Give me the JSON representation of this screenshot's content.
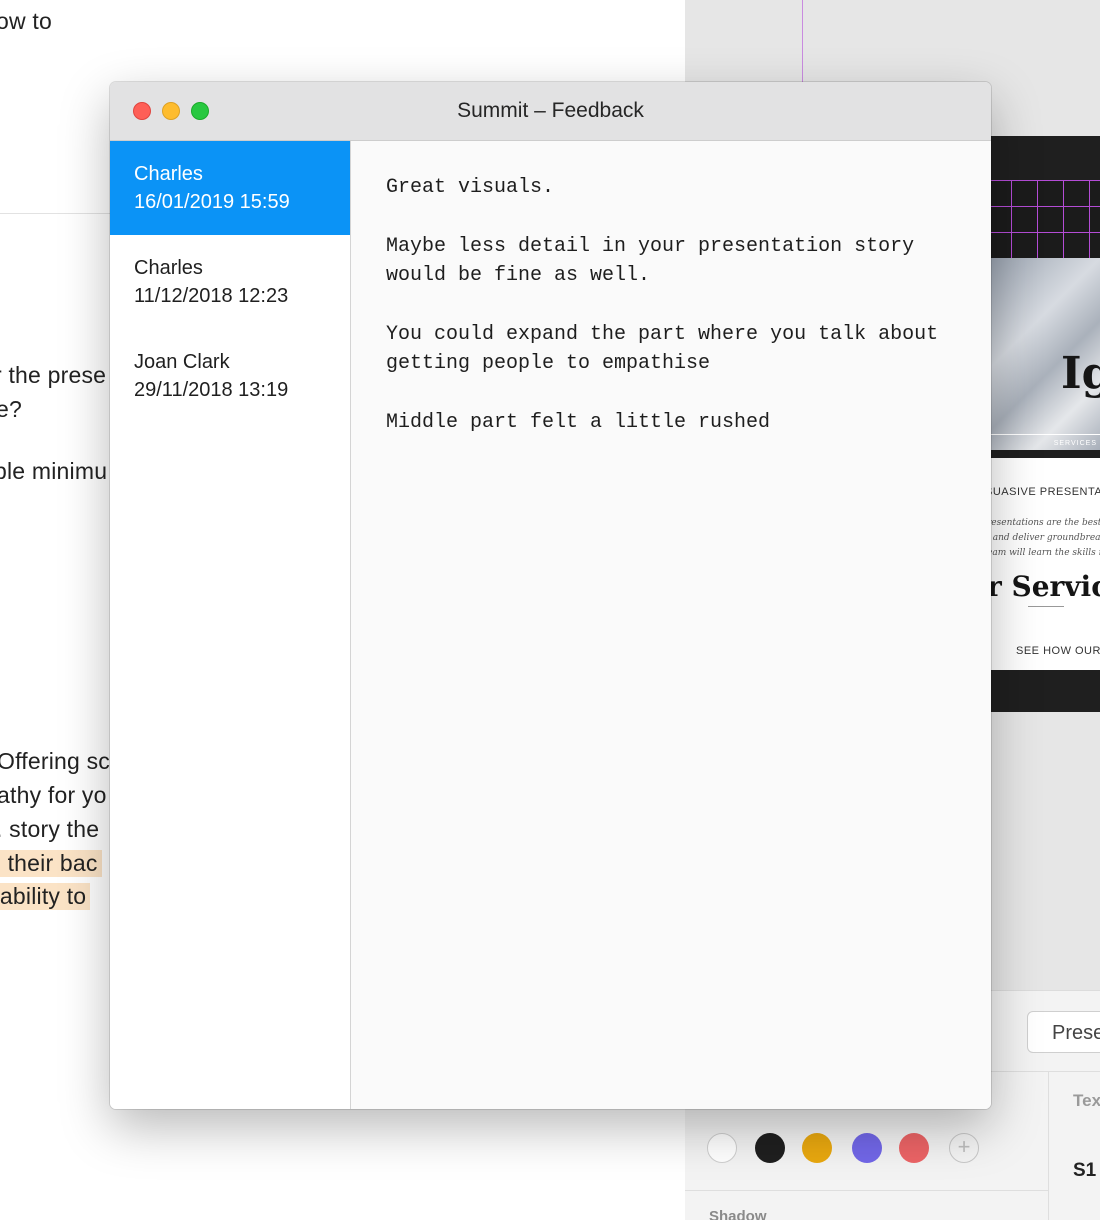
{
  "background_document": {
    "lines": [
      "ow to",
      "r the prese",
      "e?",
      "ble minimu",
      "Offering sc",
      "athy for yo",
      ". story the",
      "n their bac",
      "l ability to"
    ]
  },
  "background_app": {
    "slide": {
      "big_text": "Ig",
      "services_label": "SERVICES",
      "persuasive": "SUASIVE PRESENTA",
      "italic_lines": [
        "resentations are the best",
        ", and deliver groundbrea",
        "eam will learn the skills n"
      ],
      "services_heading": "r Servic",
      "see_how": "SEE HOW OUR"
    },
    "inspector": {
      "presets_button": "Prese",
      "text_label": "Tex",
      "style_label": "S1",
      "shadow_label": "Shadow",
      "swatch_colors": [
        "#ffffff",
        "#1f1f1f",
        "#e9a80f",
        "#7267e8",
        "#ec6466"
      ]
    }
  },
  "window": {
    "title": "Summit – Feedback",
    "controls": {
      "close_color": "#fe5f57",
      "minimize_color": "#febc2e",
      "zoom_color": "#28c840"
    },
    "feedback_list": [
      {
        "name": "Charles",
        "date": "16/01/2019 15:59",
        "selected": true
      },
      {
        "name": "Charles",
        "date": "11/12/2018 12:23",
        "selected": false
      },
      {
        "name": "Joan Clark",
        "date": "29/11/2018 13:19",
        "selected": false
      }
    ],
    "selected_color": "#0b93f6",
    "feedback_body": [
      "Great visuals.",
      "Maybe less detail in your presentation story\nwould be fine as well.",
      "You could expand the part where you talk about\ngetting people to empathise",
      "Middle part felt a little rushed"
    ]
  }
}
